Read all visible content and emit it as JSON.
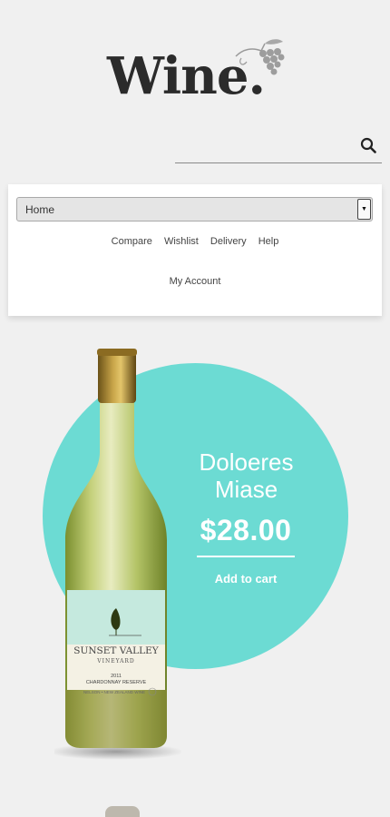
{
  "header": {
    "logo_text": "Wine.",
    "logo_icon": "grapes-icon"
  },
  "search": {
    "placeholder": "",
    "icon": "search-icon"
  },
  "nav": {
    "select_value": "Home",
    "links": [
      "Compare",
      "Wishlist",
      "Delivery",
      "Help"
    ],
    "account_label": "My Account"
  },
  "product": {
    "name_line1": "Doloeres",
    "name_line2": "Miase",
    "price": "$28.00",
    "add_to_cart": "Add to cart",
    "label": {
      "brand_line1": "SUNSET VALLEY",
      "brand_line2": "VINEYARD",
      "year": "2011",
      "variety": "CHARDONNAY RESERVE",
      "origin": "NELSON • NEW ZEALAND WINE"
    }
  },
  "colors": {
    "accent": "#6cdbd3",
    "background": "#f0f0f0",
    "logo": "#2b2b2b"
  }
}
